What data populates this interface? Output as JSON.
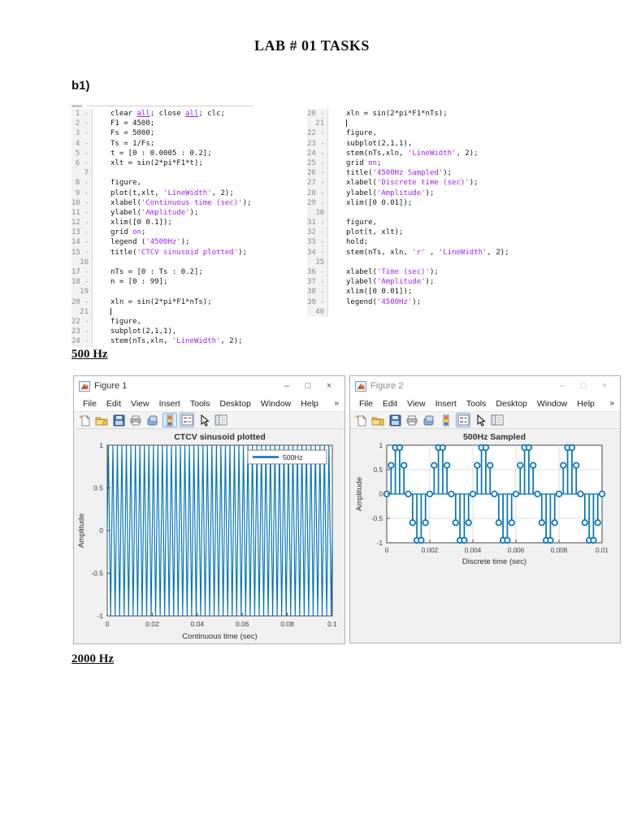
{
  "doc": {
    "title": "LAB # 01 TASKS",
    "part_label": "b1)",
    "section_500": "500 Hz",
    "section_2000": "2000 Hz"
  },
  "colors": {
    "matlab_blue": "#0072BD",
    "code_string_purple": "#A020F0",
    "figure_background": "#f0f0f0"
  },
  "code": {
    "left": [
      {
        "g": "1 -",
        "seg": [
          [
            "clear ",
            "d"
          ],
          [
            "all",
            "u"
          ],
          [
            "; close ",
            "d"
          ],
          [
            "all",
            "u"
          ],
          [
            "; clc;",
            "d"
          ]
        ]
      },
      {
        "g": "2 -",
        "seg": [
          [
            "F1 = 4500;",
            "d"
          ]
        ]
      },
      {
        "g": "3 -",
        "seg": [
          [
            "Fs = 5000;",
            "d"
          ]
        ]
      },
      {
        "g": "4 -",
        "seg": [
          [
            "Ts = 1/Fs;",
            "d"
          ]
        ]
      },
      {
        "g": "5 -",
        "seg": [
          [
            "t = [0 : 0.0005 : 0.2];",
            "d"
          ]
        ]
      },
      {
        "g": "6 -",
        "seg": [
          [
            "xlt = sin(2*pi*F1*t);",
            "d"
          ]
        ]
      },
      {
        "g": "7",
        "seg": []
      },
      {
        "g": "8 -",
        "seg": [
          [
            "figure,",
            "d"
          ]
        ]
      },
      {
        "g": "9 -",
        "seg": [
          [
            "plot(t,xlt, ",
            "d"
          ],
          [
            "'LineWidth'",
            "p"
          ],
          [
            ", 2);",
            "d"
          ]
        ]
      },
      {
        "g": "10 -",
        "seg": [
          [
            "xlabel(",
            "d"
          ],
          [
            "'Continuous time (sec)'",
            "p"
          ],
          [
            ");",
            "d"
          ]
        ]
      },
      {
        "g": "11 -",
        "seg": [
          [
            "ylabel(",
            "d"
          ],
          [
            "'Amplitude'",
            "p"
          ],
          [
            ");",
            "d"
          ]
        ]
      },
      {
        "g": "12 -",
        "seg": [
          [
            "xlim([0 0.1]);",
            "d"
          ]
        ]
      },
      {
        "g": "13 -",
        "seg": [
          [
            "grid ",
            "d"
          ],
          [
            "on",
            "p"
          ],
          [
            ";",
            "d"
          ]
        ]
      },
      {
        "g": "14 -",
        "seg": [
          [
            "legend (",
            "d"
          ],
          [
            "'4500Hz'",
            "p"
          ],
          [
            ");",
            "d"
          ]
        ]
      },
      {
        "g": "15 -",
        "seg": [
          [
            "title(",
            "d"
          ],
          [
            "'CTCV sinusoid plotted'",
            "p"
          ],
          [
            ");",
            "d"
          ]
        ]
      },
      {
        "g": "16",
        "seg": []
      },
      {
        "g": "17 -",
        "seg": [
          [
            "nTs = [0 : Ts : 0.2];",
            "d"
          ]
        ]
      },
      {
        "g": "18 -",
        "seg": [
          [
            "n = [0 : 99];",
            "d"
          ]
        ]
      },
      {
        "g": "19",
        "seg": []
      },
      {
        "g": "20 -",
        "seg": [
          [
            "xln = sin(2*pi*F1*nTs);",
            "d"
          ]
        ]
      },
      {
        "g": "21",
        "seg": [
          [
            "",
            "c"
          ]
        ]
      },
      {
        "g": "22 -",
        "seg": [
          [
            "figure,",
            "d"
          ]
        ]
      },
      {
        "g": "23 -",
        "seg": [
          [
            "subplot(2,1,1),",
            "d"
          ]
        ]
      },
      {
        "g": "24 -",
        "seg": [
          [
            "stem(nTs,xln, ",
            "d"
          ],
          [
            "'LineWidth'",
            "p"
          ],
          [
            ", 2);",
            "d"
          ]
        ]
      }
    ],
    "right": [
      {
        "g": "20 -",
        "seg": [
          [
            "xln = sin(2*pi*F1*nTs);",
            "d"
          ]
        ]
      },
      {
        "g": "21",
        "seg": [
          [
            "",
            "c"
          ]
        ]
      },
      {
        "g": "22 -",
        "seg": [
          [
            "figure,",
            "d"
          ]
        ]
      },
      {
        "g": "23 -",
        "seg": [
          [
            "subplot(2,1,1),",
            "d"
          ]
        ]
      },
      {
        "g": "24 -",
        "seg": [
          [
            "stem(nTs,xln, ",
            "d"
          ],
          [
            "'LineWidth'",
            "p"
          ],
          [
            ", 2);",
            "d"
          ]
        ]
      },
      {
        "g": "25 -",
        "seg": [
          [
            "grid ",
            "d"
          ],
          [
            "on",
            "p"
          ],
          [
            ";",
            "d"
          ]
        ]
      },
      {
        "g": "26 -",
        "seg": [
          [
            "title(",
            "d"
          ],
          [
            "'4500Hz Sampled'",
            "p"
          ],
          [
            ");",
            "d"
          ]
        ]
      },
      {
        "g": "27 -",
        "seg": [
          [
            "xlabel(",
            "d"
          ],
          [
            "'Discrete time (sec)'",
            "p"
          ],
          [
            ");",
            "d"
          ]
        ]
      },
      {
        "g": "28 -",
        "seg": [
          [
            "ylabel(",
            "d"
          ],
          [
            "'Amplitude'",
            "p"
          ],
          [
            ");",
            "d"
          ]
        ]
      },
      {
        "g": "29 -",
        "seg": [
          [
            "xlim([0 0.01]);",
            "d"
          ]
        ]
      },
      {
        "g": "30",
        "seg": []
      },
      {
        "g": "31 -",
        "seg": [
          [
            "figure,",
            "d"
          ]
        ]
      },
      {
        "g": "32 -",
        "seg": [
          [
            "plot(t, xlt);",
            "d"
          ]
        ]
      },
      {
        "g": "33 -",
        "seg": [
          [
            "hold;",
            "d"
          ]
        ]
      },
      {
        "g": "34 -",
        "seg": [
          [
            "stem(nTs, xln, ",
            "d"
          ],
          [
            "'r'",
            "p"
          ],
          [
            " , ",
            "d"
          ],
          [
            "'LineWidth'",
            "p"
          ],
          [
            ", 2);",
            "d"
          ]
        ]
      },
      {
        "g": "35",
        "seg": []
      },
      {
        "g": "36 -",
        "seg": [
          [
            "xlabel(",
            "d"
          ],
          [
            "'Time (sec)'",
            "p"
          ],
          [
            ");",
            "d"
          ]
        ]
      },
      {
        "g": "37 -",
        "seg": [
          [
            "ylabel(",
            "d"
          ],
          [
            "'Amplitude'",
            "p"
          ],
          [
            ");",
            "d"
          ]
        ]
      },
      {
        "g": "38 -",
        "seg": [
          [
            "xlim([0 0.01]);",
            "d"
          ]
        ]
      },
      {
        "g": "39 -",
        "seg": [
          [
            "legend(",
            "d"
          ],
          [
            "'4500Hz'",
            "p"
          ],
          [
            ");",
            "d"
          ]
        ]
      },
      {
        "g": "40",
        "seg": []
      }
    ]
  },
  "figure1": {
    "window_title": "Figure 1",
    "menu": [
      "File",
      "Edit",
      "View",
      "Insert",
      "Tools",
      "Desktop",
      "Window",
      "Help"
    ],
    "menu_overflow": "»",
    "controls": {
      "minimize": "–",
      "maximize": "□",
      "close": "×"
    },
    "toolbar_icons": [
      "new-file",
      "open-file",
      "save",
      "print",
      "duplicate-figure",
      "insert-colorbar",
      "insert-legend",
      "pointer",
      "property-editor"
    ]
  },
  "figure2": {
    "window_title": "Figure 2",
    "menu": [
      "File",
      "Edit",
      "View",
      "Insert",
      "Tools",
      "Desktop",
      "Window",
      "Help"
    ],
    "menu_overflow": "»",
    "controls": {
      "minimize": "–",
      "maximize": "□",
      "close": "×"
    },
    "toolbar_icons": [
      "new-file",
      "open-file",
      "save",
      "print",
      "duplicate-figure",
      "insert-colorbar",
      "insert-legend",
      "pointer",
      "property-editor"
    ]
  },
  "chart_data": [
    {
      "type": "line",
      "window": "Figure 1",
      "title": "CTCV sinusoid plotted",
      "xlabel": "Continuous time (sec)",
      "ylabel": "Amplitude",
      "xlim": [
        0,
        0.1
      ],
      "ylim": [
        -1,
        1
      ],
      "xticks": [
        "0",
        "0.02",
        "0.04",
        "0.06",
        "0.08",
        "0.1"
      ],
      "yticks": [
        "1",
        "0.5",
        "0",
        "-0.5",
        "-1"
      ],
      "grid": false,
      "legend": [
        {
          "label": "500Hz",
          "color": "#0072BD"
        }
      ],
      "legend_position": "top-right",
      "line_color": "#0072BD",
      "signal": {
        "description": "sin(2*pi*500*t)",
        "freq_hz": 500,
        "amplitude": 1,
        "t_start": 0,
        "t_step": 0.0005,
        "t_end": 0.1
      }
    },
    {
      "type": "stem",
      "window": "Figure 2",
      "title": "500Hz Sampled",
      "xlabel": "Discrete time (sec)",
      "ylabel": "Amplitude",
      "xlim": [
        0,
        0.01
      ],
      "ylim": [
        -1,
        1
      ],
      "xticks": [
        "0",
        "0.002",
        "0.004",
        "0.006",
        "0.008",
        "0.01"
      ],
      "yticks": [
        "1",
        "0.5",
        "0",
        "-0.5",
        "-1"
      ],
      "grid": true,
      "marker": "open-circle",
      "color": "#0072BD",
      "baseline": 0,
      "x_start": 0,
      "x_step": 0.0002,
      "values": [
        0,
        0.588,
        0.951,
        0.951,
        0.588,
        0,
        -0.588,
        -0.951,
        -0.951,
        -0.588,
        0,
        0.588,
        0.951,
        0.951,
        0.588,
        0,
        -0.588,
        -0.951,
        -0.951,
        -0.588,
        0,
        0.588,
        0.951,
        0.951,
        0.588,
        0,
        -0.588,
        -0.951,
        -0.951,
        -0.588,
        0,
        0.588,
        0.951,
        0.951,
        0.588,
        0,
        -0.588,
        -0.951,
        -0.951,
        -0.588,
        0,
        0.588,
        0.951,
        0.951,
        0.588,
        0,
        -0.588,
        -0.951,
        -0.951,
        -0.588,
        0
      ]
    }
  ]
}
